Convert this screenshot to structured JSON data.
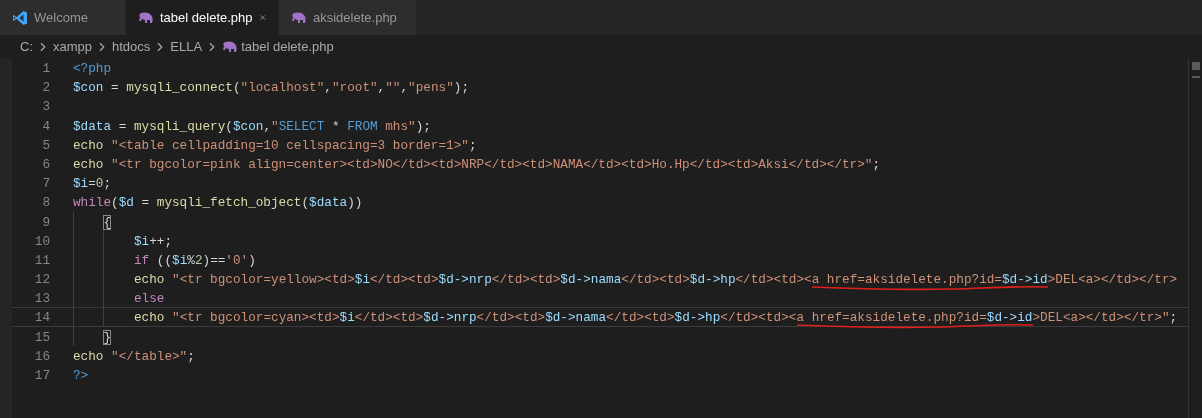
{
  "tabs": [
    {
      "label": "Welcome",
      "kind": "welcome",
      "selected": false
    },
    {
      "label": "tabel delete.php",
      "kind": "php-file",
      "selected": true
    },
    {
      "label": "aksidelete.php",
      "kind": "php-file",
      "selected": false
    }
  ],
  "breadcrumb": [
    {
      "label": "C:",
      "kind": "folder"
    },
    {
      "label": "xampp",
      "kind": "folder"
    },
    {
      "label": "htdocs",
      "kind": "folder"
    },
    {
      "label": "ELLA",
      "kind": "folder"
    },
    {
      "label": "tabel delete.php",
      "kind": "php-file"
    }
  ],
  "editor": {
    "lines": [
      {
        "number": "1",
        "current": false,
        "tokens": [
          {
            "text": "<?php",
            "kind": "tag"
          }
        ]
      },
      {
        "number": "2",
        "current": false,
        "tokens": [
          {
            "text": "$con",
            "kind": "var"
          },
          {
            "text": " = ",
            "kind": "punct"
          },
          {
            "text": "mysqli_connect",
            "kind": "func"
          },
          {
            "text": "(",
            "kind": "punct"
          },
          {
            "text": "\"localhost\"",
            "kind": "str"
          },
          {
            "text": ",",
            "kind": "punct"
          },
          {
            "text": "\"root\"",
            "kind": "str"
          },
          {
            "text": ",",
            "kind": "punct"
          },
          {
            "text": "\"\"",
            "kind": "str"
          },
          {
            "text": ",",
            "kind": "punct"
          },
          {
            "text": "\"pens\"",
            "kind": "str"
          },
          {
            "text": ");",
            "kind": "punct"
          }
        ]
      },
      {
        "number": "3",
        "current": false
      },
      {
        "number": "4",
        "current": false,
        "tokens": [
          {
            "text": "$data",
            "kind": "var"
          },
          {
            "text": " = ",
            "kind": "punct"
          },
          {
            "text": "mysqli_query",
            "kind": "func"
          },
          {
            "text": "(",
            "kind": "punct"
          },
          {
            "text": "$con",
            "kind": "var"
          },
          {
            "text": ",",
            "kind": "punct"
          },
          {
            "text": "\"",
            "kind": "str"
          },
          {
            "text": "SELECT",
            "kind": "sql"
          },
          {
            "text": " * ",
            "kind": "punct"
          },
          {
            "text": "FROM",
            "kind": "sql"
          },
          {
            "text": " mhs\"",
            "kind": "str"
          },
          {
            "text": ");",
            "kind": "punct"
          }
        ]
      },
      {
        "number": "5",
        "current": false,
        "tokens": [
          {
            "text": "echo",
            "kind": "func"
          },
          {
            "text": " \"<table cellpadding=10 cellspacing=3 border=1>\"",
            "kind": "str"
          },
          {
            "text": ";",
            "kind": "punct"
          }
        ]
      },
      {
        "number": "6",
        "current": false,
        "tokens": [
          {
            "text": "echo",
            "kind": "func"
          },
          {
            "text": " \"<tr bgcolor=pink align=center><td>NO</td><td>NRP</td><td>NAMA</td><td>Ho.Hp</td><td>Aksi</td></tr>\"",
            "kind": "str"
          },
          {
            "text": ";",
            "kind": "punct"
          }
        ]
      },
      {
        "number": "7",
        "current": false,
        "tokens": [
          {
            "text": "$i",
            "kind": "var"
          },
          {
            "text": "=",
            "kind": "punct"
          },
          {
            "text": "0",
            "kind": "num"
          },
          {
            "text": ";",
            "kind": "punct"
          }
        ]
      },
      {
        "number": "8",
        "current": false,
        "tokens": [
          {
            "text": "while",
            "kind": "kw"
          },
          {
            "text": "(",
            "kind": "punct"
          },
          {
            "text": "$d",
            "kind": "var"
          },
          {
            "text": " = ",
            "kind": "punct"
          },
          {
            "text": "mysqli_fetch_object",
            "kind": "func"
          },
          {
            "text": "(",
            "kind": "punct"
          },
          {
            "text": "$data",
            "kind": "var"
          },
          {
            "text": "))",
            "kind": "punct"
          }
        ],
        "children": [
          {
            "number": "9",
            "current": false,
            "tokens": [
              {
                "text": "{",
                "kind": "punct",
                "matched": true
              }
            ],
            "children": [
              {
                "number": "10",
                "current": false,
                "tokens": [
                  {
                    "text": "$i",
                    "kind": "var"
                  },
                  {
                    "text": "++;",
                    "kind": "punct"
                  }
                ]
              },
              {
                "number": "11",
                "current": false,
                "tokens": [
                  {
                    "text": "if",
                    "kind": "kw"
                  },
                  {
                    "text": " ((",
                    "kind": "punct"
                  },
                  {
                    "text": "$i",
                    "kind": "var"
                  },
                  {
                    "text": "%",
                    "kind": "punct"
                  },
                  {
                    "text": "2",
                    "kind": "num"
                  },
                  {
                    "text": ")==",
                    "kind": "punct"
                  },
                  {
                    "text": "'0'",
                    "kind": "str"
                  },
                  {
                    "text": ")",
                    "kind": "punct"
                  }
                ]
              },
              {
                "number": "12",
                "current": false,
                "tokens": [
                  {
                    "text": "echo",
                    "kind": "func"
                  },
                  {
                    "text": " \"<tr bgcolor=yellow><td>",
                    "kind": "str"
                  },
                  {
                    "text": "$i",
                    "kind": "var"
                  },
                  {
                    "text": "</td><td>",
                    "kind": "str"
                  },
                  {
                    "text": "$d->nrp",
                    "kind": "var"
                  },
                  {
                    "text": "</td><td>",
                    "kind": "str"
                  },
                  {
                    "text": "$d->nama",
                    "kind": "var"
                  },
                  {
                    "text": "</td><td>",
                    "kind": "str"
                  },
                  {
                    "text": "$d->hp",
                    "kind": "var"
                  },
                  {
                    "text": "</td><td><",
                    "kind": "str"
                  },
                  {
                    "text": "a href=aksidelete.php?id=",
                    "kind": "str",
                    "underlined": true
                  },
                  {
                    "text": "$d->id",
                    "kind": "var",
                    "underlined": true
                  },
                  {
                    "text": ">DEL<a></td></tr>",
                    "kind": "str"
                  }
                ]
              },
              {
                "number": "13",
                "current": false,
                "tokens": [
                  {
                    "text": "else",
                    "kind": "kw"
                  }
                ]
              },
              {
                "number": "14",
                "current": true,
                "tokens": [
                  {
                    "text": "echo",
                    "kind": "func"
                  },
                  {
                    "text": " \"<tr bgcolor=cyan><td>",
                    "kind": "str"
                  },
                  {
                    "text": "$i",
                    "kind": "var"
                  },
                  {
                    "text": "</td><td>",
                    "kind": "str"
                  },
                  {
                    "text": "$d->nrp",
                    "kind": "var"
                  },
                  {
                    "text": "</td><td>",
                    "kind": "str"
                  },
                  {
                    "text": "$d->nama",
                    "kind": "var"
                  },
                  {
                    "text": "</td><td>",
                    "kind": "str"
                  },
                  {
                    "text": "$d->hp",
                    "kind": "var"
                  },
                  {
                    "text": "</td><td><",
                    "kind": "str"
                  },
                  {
                    "text": "a href=aksidelete.php?id=",
                    "kind": "str",
                    "underlined": true
                  },
                  {
                    "text": "$d->id",
                    "kind": "var",
                    "underlined": true
                  },
                  {
                    "text": ">DEL<a></td></tr>\"",
                    "kind": "str"
                  },
                  {
                    "text": ";",
                    "kind": "punct"
                  }
                ]
              }
            ]
          },
          {
            "number": "15",
            "current": false,
            "tokens": [
              {
                "text": "}",
                "kind": "punct",
                "matched": true
              }
            ]
          }
        ]
      },
      {
        "number": "16",
        "current": false,
        "tokens": [
          {
            "text": "echo",
            "kind": "func"
          },
          {
            "text": " \"</table>\"",
            "kind": "str"
          },
          {
            "text": ";",
            "kind": "punct"
          }
        ]
      },
      {
        "number": "17",
        "current": false,
        "tokens": [
          {
            "text": "?>",
            "kind": "tag"
          }
        ]
      }
    ]
  }
}
